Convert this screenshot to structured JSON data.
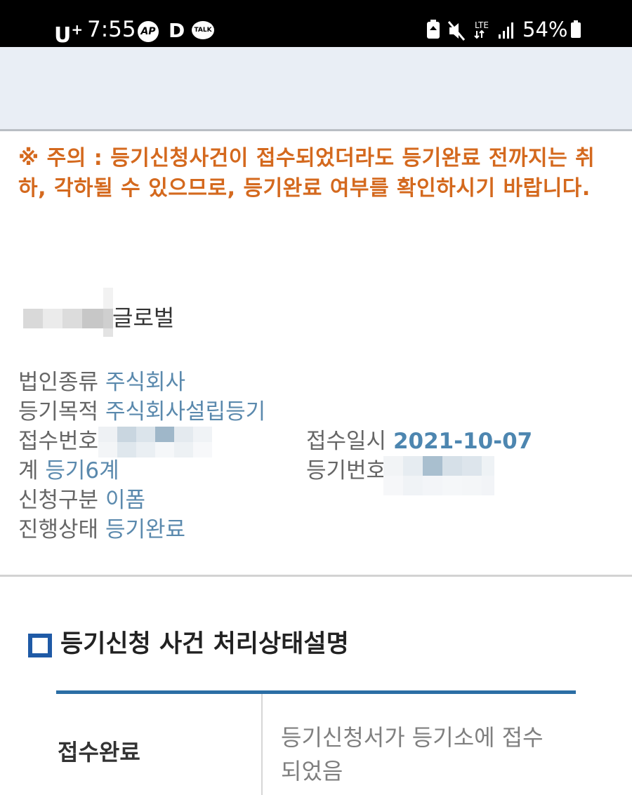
{
  "status_bar": {
    "carrier": "U",
    "carrier_sup": "+",
    "time": "7:55",
    "app_icons": [
      "AP",
      "D",
      "TALK"
    ],
    "network": "LTE",
    "battery": "54%"
  },
  "notice": {
    "text": "※ 주의 : 등기신청사건이 접수되었더라도 등기완료 전까지는 취하, 각하될 수 있으므로, 등기완료 여부를 확인하시기 바랍니다."
  },
  "company": {
    "name_visible": "글로벌"
  },
  "details": {
    "corp_type_label": "법인종류",
    "corp_type_value": "주식회사",
    "purpose_label": "등기목적",
    "purpose_value": "주식회사설립등기",
    "receipt_no_label": "접수번호",
    "receipt_date_label": "접수일시",
    "receipt_date_value": "2021-10-07",
    "team_label": "계",
    "team_value": "등기6계",
    "reg_no_label": "등기번호",
    "application_label": "신청구분",
    "application_value": "이폼",
    "status_label": "진행상태",
    "status_value": "등기완료"
  },
  "section": {
    "title": "등기신청 사건 처리상태설명"
  },
  "status_table": {
    "rows": [
      {
        "status": "접수완료",
        "description": "등기신청서가 등기소에 접수되었음"
      }
    ]
  },
  "colors": {
    "notice": "#d4691e",
    "value": "#5a89ad",
    "accent": "#2b6ea5"
  }
}
